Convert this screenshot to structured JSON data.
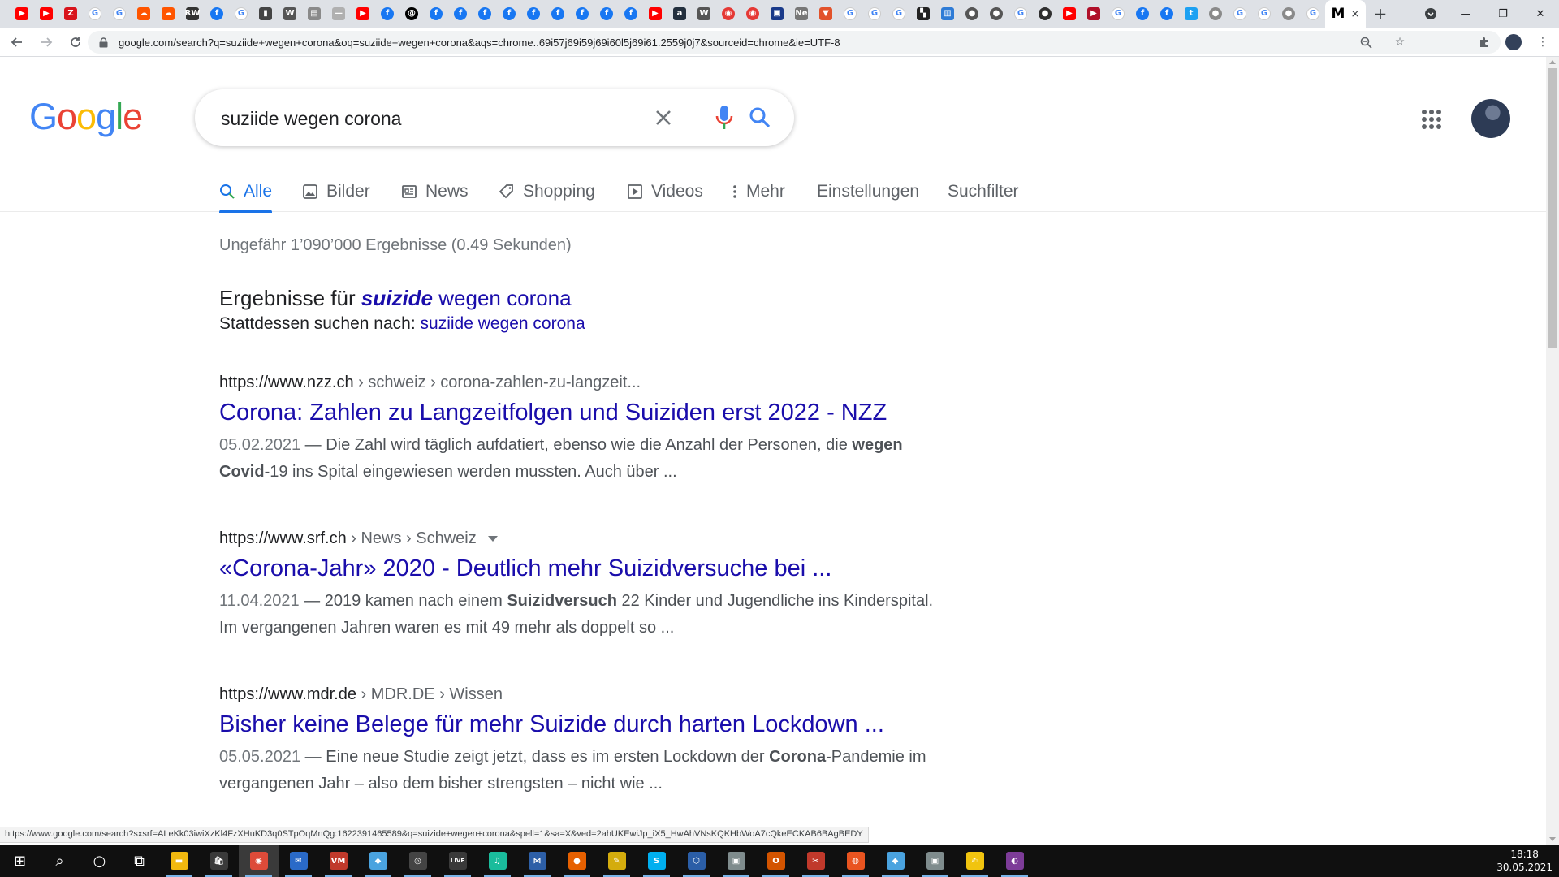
{
  "browser": {
    "pinned_tabs": [
      {
        "icon": "youtube-icon",
        "glyph": "▶",
        "color": "#ff0000"
      },
      {
        "icon": "youtube-icon",
        "glyph": "▶",
        "color": "#ff0000"
      },
      {
        "icon": "zeitung-z-icon",
        "glyph": "Z",
        "color": "#d8141c"
      },
      {
        "icon": "google-icon",
        "glyph": "G",
        "color": "#4285f4"
      },
      {
        "icon": "google-icon",
        "glyph": "G",
        "color": "#4285f4"
      },
      {
        "icon": "soundcloud-icon",
        "glyph": "☁",
        "color": "#ff5500"
      },
      {
        "icon": "soundcloud-icon",
        "glyph": "☁",
        "color": "#ff5500"
      },
      {
        "icon": "rw-icon",
        "glyph": "RW",
        "color": "#333333"
      },
      {
        "icon": "facebook-icon",
        "glyph": "f",
        "color": "#1877f2"
      },
      {
        "icon": "google-icon",
        "glyph": "G",
        "color": "#4285f4"
      },
      {
        "icon": "bookmark-dark-icon",
        "glyph": "▮",
        "color": "#444444"
      },
      {
        "icon": "wikipedia-icon",
        "glyph": "W",
        "color": "#555555"
      },
      {
        "icon": "document-icon",
        "glyph": "▤",
        "color": "#8a8a8a"
      },
      {
        "icon": "blank-page-icon",
        "glyph": "—",
        "color": "#b0b0b0"
      },
      {
        "icon": "youtube-icon",
        "glyph": "▶",
        "color": "#ff0000"
      },
      {
        "icon": "facebook-icon",
        "glyph": "f",
        "color": "#1877f2"
      },
      {
        "icon": "threads-icon",
        "glyph": "@",
        "color": "#000000"
      },
      {
        "icon": "facebook-icon",
        "glyph": "f",
        "color": "#1877f2"
      },
      {
        "icon": "facebook-icon",
        "glyph": "f",
        "color": "#1877f2"
      },
      {
        "icon": "facebook-icon",
        "glyph": "f",
        "color": "#1877f2"
      },
      {
        "icon": "facebook-icon",
        "glyph": "f",
        "color": "#1877f2"
      },
      {
        "icon": "facebook-icon",
        "glyph": "f",
        "color": "#1877f2"
      },
      {
        "icon": "facebook-icon",
        "glyph": "f",
        "color": "#1877f2"
      },
      {
        "icon": "facebook-icon",
        "glyph": "f",
        "color": "#1877f2"
      },
      {
        "icon": "facebook-icon",
        "glyph": "f",
        "color": "#1877f2"
      },
      {
        "icon": "facebook-icon",
        "glyph": "f",
        "color": "#1877f2"
      },
      {
        "icon": "youtube-icon",
        "glyph": "▶",
        "color": "#ff0000"
      },
      {
        "icon": "amazon-icon",
        "glyph": "a",
        "color": "#232f3e"
      },
      {
        "icon": "wikipedia-icon",
        "glyph": "W",
        "color": "#555555"
      },
      {
        "icon": "record-icon",
        "glyph": "◉",
        "color": "#e53935"
      },
      {
        "icon": "record-icon",
        "glyph": "◉",
        "color": "#e53935"
      },
      {
        "icon": "save-icon",
        "glyph": "▣",
        "color": "#1a3a8a"
      },
      {
        "icon": "news-ne-icon",
        "glyph": "Ne",
        "color": "#777777"
      },
      {
        "icon": "fox-icon",
        "glyph": "▼",
        "color": "#e2522b"
      },
      {
        "icon": "google-icon",
        "glyph": "G",
        "color": "#4285f4"
      },
      {
        "icon": "google-icon",
        "glyph": "G",
        "color": "#4285f4"
      },
      {
        "icon": "google-icon",
        "glyph": "G",
        "color": "#4285f4"
      },
      {
        "icon": "clapper-icon",
        "glyph": "▚",
        "color": "#222222"
      },
      {
        "icon": "bar-chart-icon",
        "glyph": "▥",
        "color": "#2e7bd6"
      },
      {
        "icon": "globe-icon",
        "glyph": "●",
        "color": "#555555"
      },
      {
        "icon": "globe-icon",
        "glyph": "●",
        "color": "#555555"
      },
      {
        "icon": "google-icon",
        "glyph": "G",
        "color": "#4285f4"
      },
      {
        "icon": "circle-logo-icon",
        "glyph": "●",
        "color": "#2f2f2f"
      },
      {
        "icon": "youtube-icon",
        "glyph": "▶",
        "color": "#ff0000"
      },
      {
        "icon": "youtube-dark-icon",
        "glyph": "▶",
        "color": "#b0102a"
      },
      {
        "icon": "google-icon",
        "glyph": "G",
        "color": "#4285f4"
      },
      {
        "icon": "facebook-icon",
        "glyph": "f",
        "color": "#1877f2"
      },
      {
        "icon": "facebook-icon",
        "glyph": "f",
        "color": "#1877f2"
      },
      {
        "icon": "twitter-icon",
        "glyph": "t",
        "color": "#1da1f2"
      },
      {
        "icon": "globe-icon",
        "glyph": "●",
        "color": "#8a8a8a"
      },
      {
        "icon": "google-icon",
        "glyph": "G",
        "color": "#4285f4"
      },
      {
        "icon": "google-icon",
        "glyph": "G",
        "color": "#4285f4"
      },
      {
        "icon": "globe-icon",
        "glyph": "●",
        "color": "#8a8a8a"
      },
      {
        "icon": "google-icon",
        "glyph": "G",
        "color": "#4285f4"
      }
    ],
    "active_tab_label": "M",
    "active_tab_close": "×",
    "new_tab": "+",
    "url": "google.com/search?q=suziide+wegen+corona&oq=suziide+wegen+corona&aqs=chrome..69i57j69i59j69i60l5j69i61.2559j0j7&sourceid=chrome&ie=UTF-8",
    "status_url": "https://www.google.com/search?sxsrf=ALeKk03iwiXzKl4FzXHuKD3q0STpOqMnQg:1622391465589&q=suizide+wegen+corona&spell=1&sa=X&ved=2ahUKEwiJp_iX5_HwAhVNsKQKHbWoA7cQkeECKAB6BAgBEDY"
  },
  "google": {
    "logo_letters": [
      {
        "ch": "G",
        "color": "#4285f4"
      },
      {
        "ch": "o",
        "color": "#ea4335"
      },
      {
        "ch": "o",
        "color": "#fbbc05"
      },
      {
        "ch": "g",
        "color": "#4285f4"
      },
      {
        "ch": "l",
        "color": "#34a853"
      },
      {
        "ch": "e",
        "color": "#ea4335"
      }
    ],
    "query": "suziide wegen corona",
    "tabs": [
      {
        "label": "Alle",
        "icon": "search-icon",
        "active": true
      },
      {
        "label": "Bilder",
        "icon": "image-icon",
        "active": false
      },
      {
        "label": "News",
        "icon": "newspaper-icon",
        "active": false
      },
      {
        "label": "Shopping",
        "icon": "tag-icon",
        "active": false
      },
      {
        "label": "Videos",
        "icon": "play-icon",
        "active": false
      },
      {
        "label": "Mehr",
        "icon": "more-vert-icon",
        "active": false
      },
      {
        "label": "Einstellungen",
        "icon": "",
        "active": false
      },
      {
        "label": "Suchfilter",
        "icon": "",
        "active": false
      }
    ],
    "stats": "Ungefähr 1’090’000 Ergebnisse (0.49 Sekunden)",
    "spell": {
      "prefix": "Ergebnisse für",
      "corrected_bold": "suizide",
      "corrected_rest": "wegen corona",
      "instead_label": "Stattdessen suchen nach:",
      "instead_query": "suziide wegen corona"
    },
    "results": [
      {
        "domain": "https://www.nzz.ch",
        "path": " › schweiz › corona-zahlen-zu-langzeit...",
        "has_menu": false,
        "title": "Corona: Zahlen zu Langzeitfolgen und Suiziden erst 2022 - NZZ",
        "date": "05.02.2021",
        "snippet_parts": [
          {
            "t": " — Die Zahl wird täglich aufdatiert, ebenso wie die Anzahl der Personen, die ",
            "b": false
          },
          {
            "t": "wegen Covid",
            "b": true
          },
          {
            "t": "-19 ins Spital eingewiesen werden mussten. Auch über ...",
            "b": false
          }
        ]
      },
      {
        "domain": "https://www.srf.ch",
        "path": " › News › Schweiz",
        "has_menu": true,
        "title": "«Corona-Jahr» 2020 - Deutlich mehr Suizidversuche bei ...",
        "date": "11.04.2021",
        "snippet_parts": [
          {
            "t": " — 2019 kamen nach einem ",
            "b": false
          },
          {
            "t": "Suizidversuch",
            "b": true
          },
          {
            "t": " 22 Kinder und Jugendliche ins Kinderspital. Im vergangenen Jahren waren es mit 49 mehr als doppelt so ...",
            "b": false
          }
        ]
      },
      {
        "domain": "https://www.mdr.de",
        "path": " › MDR.DE › Wissen",
        "has_menu": false,
        "title": "Bisher keine Belege für mehr Suizide durch harten Lockdown ...",
        "date": "05.05.2021",
        "snippet_parts": [
          {
            "t": " — Eine neue Studie zeigt jetzt, dass es im ersten Lockdown der ",
            "b": false
          },
          {
            "t": "Corona",
            "b": true
          },
          {
            "t": "-Pandemie im vergangenen Jahr – also dem bisher strengsten – nicht wie ...",
            "b": false
          }
        ]
      }
    ]
  },
  "taskbar": {
    "items": [
      {
        "icon": "windows-start-icon",
        "glyph": "⊞",
        "color": "transparent"
      },
      {
        "icon": "search-icon",
        "glyph": "⌕",
        "color": "transparent"
      },
      {
        "icon": "cortana-icon",
        "glyph": "○",
        "color": "transparent"
      },
      {
        "icon": "task-view-icon",
        "glyph": "⧉",
        "color": "transparent"
      },
      {
        "icon": "file-explorer-icon",
        "glyph": "▬",
        "color": "#f2b90f"
      },
      {
        "icon": "store-icon",
        "glyph": "🛍",
        "color": "#3a3a3a"
      },
      {
        "icon": "chrome-icon",
        "glyph": "◉",
        "color": "#dd4b39"
      },
      {
        "icon": "thunderbird-icon",
        "glyph": "✉",
        "color": "#2a6ac8"
      },
      {
        "icon": "voicemeeter-icon",
        "glyph": "VM",
        "color": "#c0392b"
      },
      {
        "icon": "chat-bubble-icon",
        "glyph": "◆",
        "color": "#4aa3df"
      },
      {
        "icon": "obs-icon",
        "glyph": "◎",
        "color": "#444444"
      },
      {
        "icon": "live-icon",
        "glyph": "LIVE",
        "color": "#3a3a3a"
      },
      {
        "icon": "audio-app-icon",
        "glyph": "♫",
        "color": "#1abc9c"
      },
      {
        "icon": "visual-studio-icon",
        "glyph": "⋈",
        "color": "#2d5fa7"
      },
      {
        "icon": "firefox-icon",
        "glyph": "●",
        "color": "#e66000"
      },
      {
        "icon": "pen-icon",
        "glyph": "✎",
        "color": "#d4ac0d"
      },
      {
        "icon": "skype-icon",
        "glyph": "S",
        "color": "#00aff0"
      },
      {
        "icon": "virtualbox-icon",
        "glyph": "⬡",
        "color": "#2b5ea7"
      },
      {
        "icon": "app-window-icon",
        "glyph": "▣",
        "color": "#7f8c8d"
      },
      {
        "icon": "office-icon",
        "glyph": "O",
        "color": "#d35400"
      },
      {
        "icon": "tool-icon",
        "glyph": "✂",
        "color": "#c0392b"
      },
      {
        "icon": "ubuntu-icon",
        "glyph": "◍",
        "color": "#e95420"
      },
      {
        "icon": "chat-bubble-icon",
        "glyph": "◆",
        "color": "#4aa3df"
      },
      {
        "icon": "app-window-icon",
        "glyph": "▣",
        "color": "#7f8c8d"
      },
      {
        "icon": "notes-icon",
        "glyph": "✍",
        "color": "#f1c40f"
      },
      {
        "icon": "tor-icon",
        "glyph": "◐",
        "color": "#7d3c98"
      }
    ],
    "time": "18:18",
    "date": "30.05.2021"
  }
}
